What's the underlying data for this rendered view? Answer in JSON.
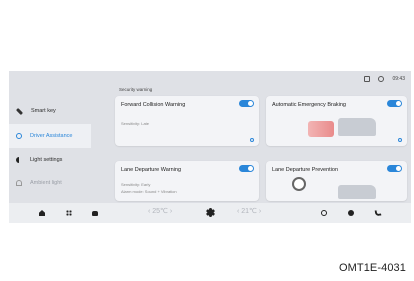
{
  "status": {
    "time": "09:43",
    "icons": [
      "settings-status-icon",
      "search-status-icon"
    ]
  },
  "sidebar": {
    "items": [
      {
        "label": "Smart key",
        "icon": "wrench-icon"
      },
      {
        "label": "Driver Assistance",
        "icon": "car-icon",
        "active": true
      },
      {
        "label": "Light settings",
        "icon": "light-icon"
      },
      {
        "label": "Ambient light",
        "icon": "person-icon"
      }
    ]
  },
  "main": {
    "section_title": "Security warning",
    "cards": [
      {
        "title": "Forward Collision Warning",
        "lines": [
          "Sensitivity:  Late"
        ],
        "enabled": true
      },
      {
        "title": "Automatic Emergency Braking",
        "lines": [],
        "enabled": true
      },
      {
        "title": "Lane Departure Warning",
        "lines": [
          "Sensitivity:  Early",
          "Alarm mode:  Sound + Vibration"
        ],
        "enabled": true
      },
      {
        "title": "Lane Departure Prevention",
        "lines": [],
        "enabled": true
      }
    ]
  },
  "bottombar": {
    "left_temp": "‹ 25℃ ›",
    "right_temp": "‹ 21℃ ›"
  },
  "caption": "OMT1E-4031",
  "colors": {
    "accent": "#2a86d9",
    "screen_bg": "#dfe1e6",
    "card_bg": "#f3f4f7"
  }
}
